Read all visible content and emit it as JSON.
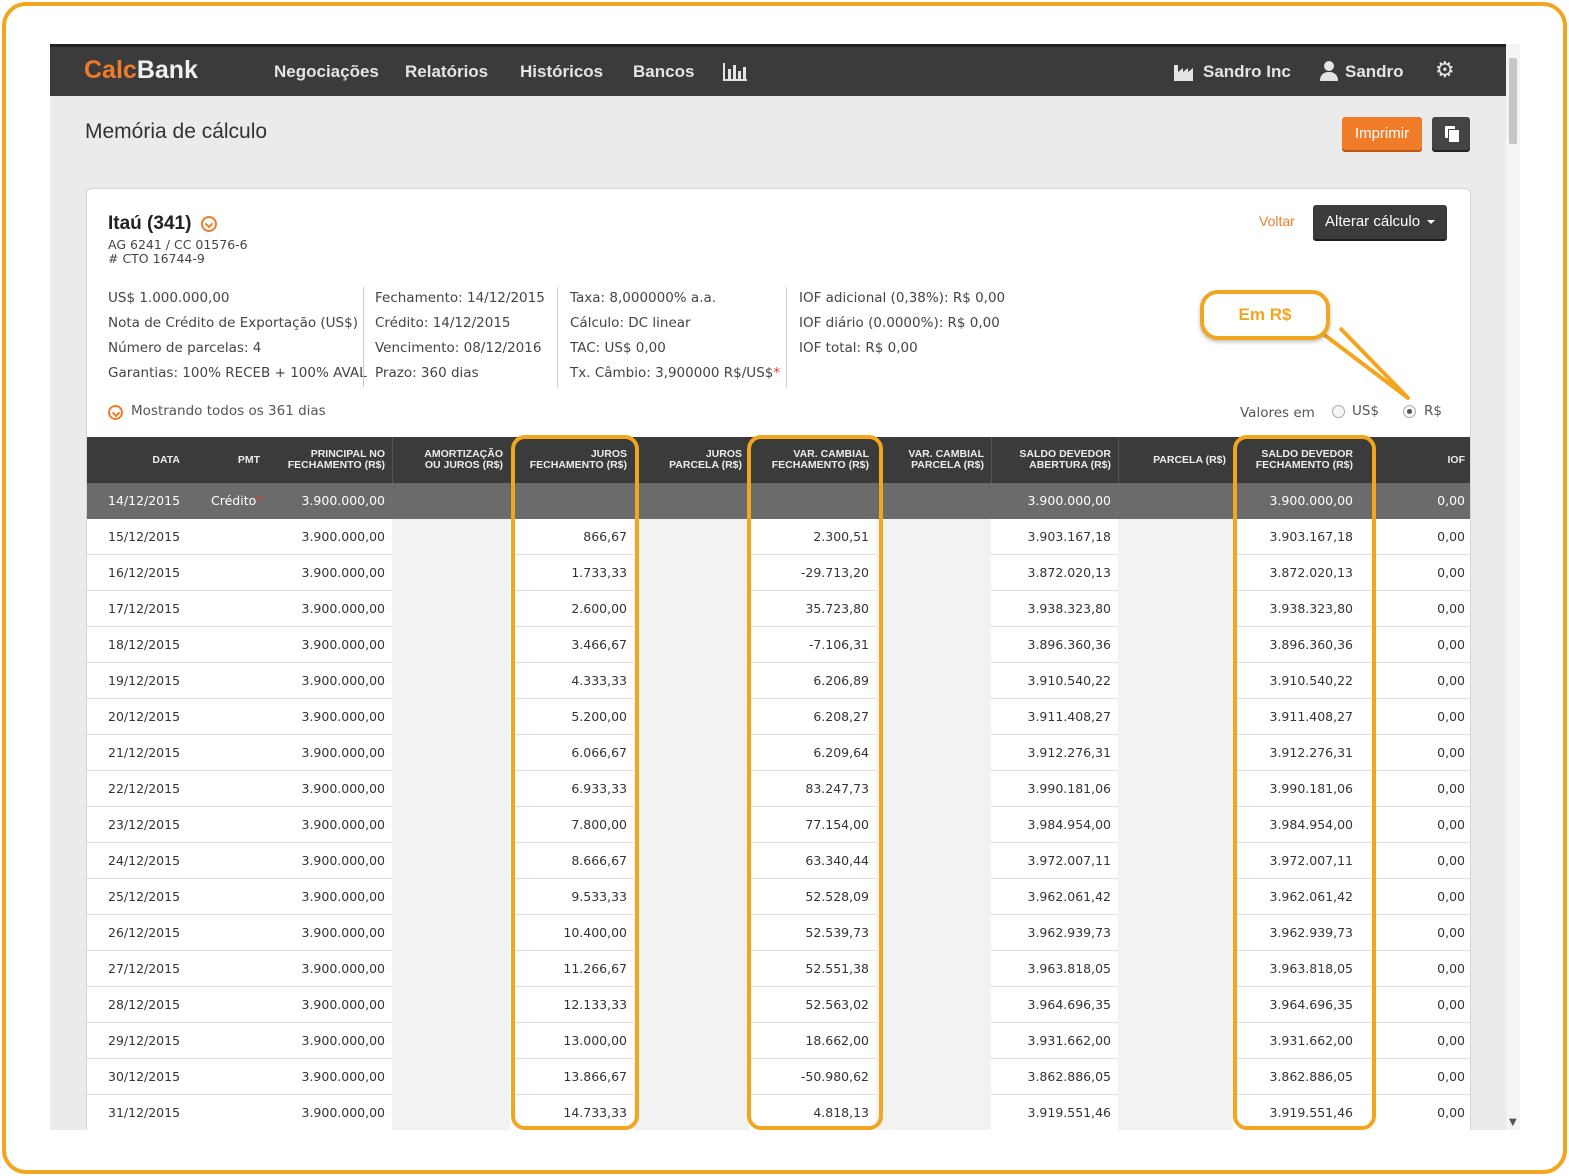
{
  "app": {
    "logo_part1": "Calc",
    "logo_part2": "Bank",
    "nav": [
      "Negociações",
      "Relatórios",
      "Históricos",
      "Bancos"
    ],
    "company": "Sandro Inc",
    "user": "Sandro",
    "icons": [
      "bar-chart-icon",
      "factory-icon",
      "user-icon",
      "gear-icon"
    ]
  },
  "page": {
    "title": "Memória de cálculo",
    "print_label": "Imprimir"
  },
  "contract": {
    "bank": "Itaú (341)",
    "agency": "AG 6241 / CC 01576-6",
    "cto": "# CTO 16744-9",
    "back_label": "Voltar",
    "alter_label": "Alterar cálculo",
    "col1": [
      "US$ 1.000.000,00",
      "Nota de Crédito de Exportação (US$)",
      "Número de parcelas: 4",
      "Garantias: 100% RECEB + 100% AVAL"
    ],
    "col2": [
      "Fechamento: 14/12/2015",
      "Crédito: 14/12/2015",
      "Vencimento: 08/12/2016",
      "Prazo: 360 dias"
    ],
    "col3": [
      "Taxa: 8,000000% a.a.",
      "Cálculo: DC linear",
      "TAC: US$ 0,00",
      "Tx. Câmbio: 3,900000 R$/US$"
    ],
    "col3_req": "*",
    "col4": [
      "IOF adicional (0,38%): R$ 0,00",
      "IOF diário (0.0000%): R$ 0,00",
      "IOF total: R$ 0,00"
    ],
    "showing": "Mostrando todos os 361 dias",
    "valores_label": "Valores em",
    "currency_options": [
      "US$",
      "R$"
    ],
    "currency_selected": "R$"
  },
  "callout": "Em R$",
  "table": {
    "headers": [
      [
        "DATA"
      ],
      [
        "PMT"
      ],
      [
        "PRINCIPAL NO",
        "FECHAMENTO (R$)"
      ],
      [
        "AMORTIZAÇÃO",
        "OU JUROS (R$)"
      ],
      [
        "JUROS",
        "FECHAMENTO (R$)"
      ],
      [
        "JUROS",
        "PARCELA (R$)"
      ],
      [
        "VAR. CAMBIAL",
        "FECHAMENTO (R$)"
      ],
      [
        "VAR. CAMBIAL",
        "PARCELA (R$)"
      ],
      [
        "SALDO DEVEDOR",
        "ABERTURA (R$)"
      ],
      [
        "PARCELA (R$)"
      ],
      [
        "SALDO DEVEDOR",
        "FECHAMENTO (R$)"
      ],
      [
        "IOF"
      ]
    ],
    "first_row": {
      "date": "14/12/2015",
      "pmt": "Crédito",
      "pmt_req": "*",
      "principal": "3.900.000,00",
      "saldo_abertura": "3.900.000,00",
      "saldo_fechamento": "3.900.000,00",
      "iof": "0,00"
    },
    "rows": [
      {
        "date": "15/12/2015",
        "principal": "3.900.000,00",
        "juros": "866,67",
        "var": "2.300,51",
        "abertura": "3.903.167,18",
        "fechamento": "3.903.167,18",
        "iof": "0,00"
      },
      {
        "date": "16/12/2015",
        "principal": "3.900.000,00",
        "juros": "1.733,33",
        "var": "-29.713,20",
        "abertura": "3.872.020,13",
        "fechamento": "3.872.020,13",
        "iof": "0,00"
      },
      {
        "date": "17/12/2015",
        "principal": "3.900.000,00",
        "juros": "2.600,00",
        "var": "35.723,80",
        "abertura": "3.938.323,80",
        "fechamento": "3.938.323,80",
        "iof": "0,00"
      },
      {
        "date": "18/12/2015",
        "principal": "3.900.000,00",
        "juros": "3.466,67",
        "var": "-7.106,31",
        "abertura": "3.896.360,36",
        "fechamento": "3.896.360,36",
        "iof": "0,00"
      },
      {
        "date": "19/12/2015",
        "principal": "3.900.000,00",
        "juros": "4.333,33",
        "var": "6.206,89",
        "abertura": "3.910.540,22",
        "fechamento": "3.910.540,22",
        "iof": "0,00"
      },
      {
        "date": "20/12/2015",
        "principal": "3.900.000,00",
        "juros": "5.200,00",
        "var": "6.208,27",
        "abertura": "3.911.408,27",
        "fechamento": "3.911.408,27",
        "iof": "0,00"
      },
      {
        "date": "21/12/2015",
        "principal": "3.900.000,00",
        "juros": "6.066,67",
        "var": "6.209,64",
        "abertura": "3.912.276,31",
        "fechamento": "3.912.276,31",
        "iof": "0,00"
      },
      {
        "date": "22/12/2015",
        "principal": "3.900.000,00",
        "juros": "6.933,33",
        "var": "83.247,73",
        "abertura": "3.990.181,06",
        "fechamento": "3.990.181,06",
        "iof": "0,00"
      },
      {
        "date": "23/12/2015",
        "principal": "3.900.000,00",
        "juros": "7.800,00",
        "var": "77.154,00",
        "abertura": "3.984.954,00",
        "fechamento": "3.984.954,00",
        "iof": "0,00"
      },
      {
        "date": "24/12/2015",
        "principal": "3.900.000,00",
        "juros": "8.666,67",
        "var": "63.340,44",
        "abertura": "3.972.007,11",
        "fechamento": "3.972.007,11",
        "iof": "0,00"
      },
      {
        "date": "25/12/2015",
        "principal": "3.900.000,00",
        "juros": "9.533,33",
        "var": "52.528,09",
        "abertura": "3.962.061,42",
        "fechamento": "3.962.061,42",
        "iof": "0,00"
      },
      {
        "date": "26/12/2015",
        "principal": "3.900.000,00",
        "juros": "10.400,00",
        "var": "52.539,73",
        "abertura": "3.962.939,73",
        "fechamento": "3.962.939,73",
        "iof": "0,00"
      },
      {
        "date": "27/12/2015",
        "principal": "3.900.000,00",
        "juros": "11.266,67",
        "var": "52.551,38",
        "abertura": "3.963.818,05",
        "fechamento": "3.963.818,05",
        "iof": "0,00"
      },
      {
        "date": "28/12/2015",
        "principal": "3.900.000,00",
        "juros": "12.133,33",
        "var": "52.563,02",
        "abertura": "3.964.696,35",
        "fechamento": "3.964.696,35",
        "iof": "0,00"
      },
      {
        "date": "29/12/2015",
        "principal": "3.900.000,00",
        "juros": "13.000,00",
        "var": "18.662,00",
        "abertura": "3.931.662,00",
        "fechamento": "3.931.662,00",
        "iof": "0,00"
      },
      {
        "date": "30/12/2015",
        "principal": "3.900.000,00",
        "juros": "13.866,67",
        "var": "-50.980,62",
        "abertura": "3.862.886,05",
        "fechamento": "3.862.886,05",
        "iof": "0,00"
      },
      {
        "date": "31/12/2015",
        "principal": "3.900.000,00",
        "juros": "14.733,33",
        "var": "4.818,13",
        "abertura": "3.919.551,46",
        "fechamento": "3.919.551,46",
        "iof": "0,00"
      }
    ]
  },
  "colors": {
    "accent": "#f07c2a",
    "highlight": "#f2a61f",
    "dark": "#3b3b3b"
  }
}
